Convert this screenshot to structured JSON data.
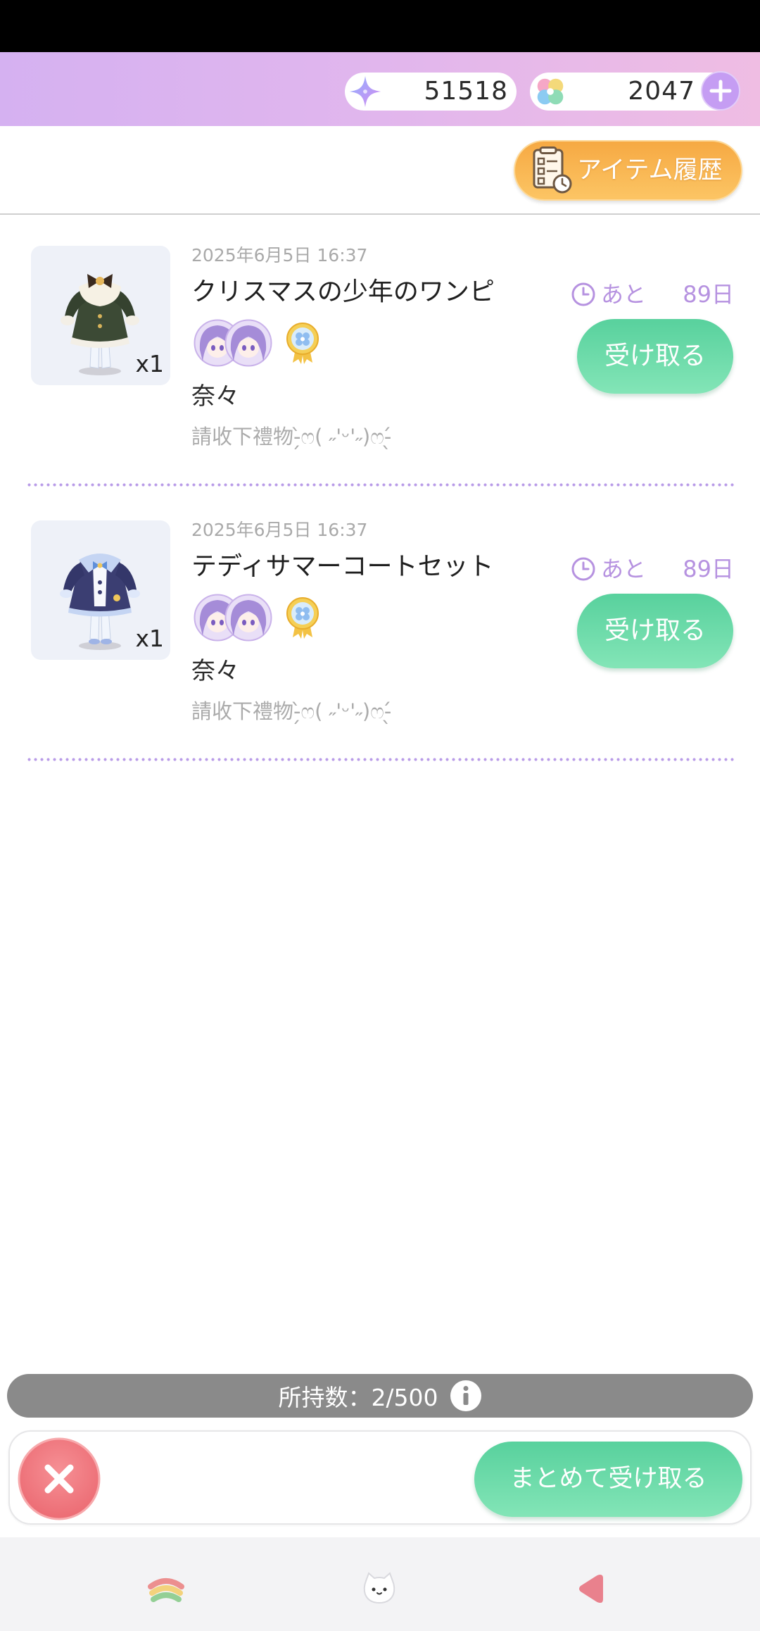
{
  "currency": {
    "primary": {
      "icon": "sparkle-icon",
      "value": "51518"
    },
    "secondary": {
      "icon": "clover-icon",
      "value": "2047"
    },
    "add_icon": "plus-icon"
  },
  "history_button": {
    "icon": "history-list-icon",
    "label": "アイテム履歴"
  },
  "gifts": [
    {
      "date": "2025年6月5日 16:37",
      "title": "クリスマスの少年のワンピ",
      "quantity": "x1",
      "sender_name": "奈々",
      "message": "請收下禮物-̗̀ෆ( ˶'ᵕ'˶)ෆ-̖́",
      "expiry_icon": "clock-icon",
      "expiry_prefix": "あと",
      "expiry_value": "89日",
      "claim_label": "受け取る"
    },
    {
      "date": "2025年6月5日 16:37",
      "title": "テディサマーコートセット",
      "quantity": "x1",
      "sender_name": "奈々",
      "message": "請收下禮物-̗̀ෆ( ˶'ᵕ'˶)ෆ-̖́",
      "expiry_icon": "clock-icon",
      "expiry_prefix": "あと",
      "expiry_value": "89日",
      "claim_label": "受け取る"
    }
  ],
  "footer": {
    "holding_label": "所持数：",
    "holding_count": "2/500",
    "info_icon": "info-icon",
    "close_icon": "close-icon",
    "claim_all_label": "まとめて受け取る"
  },
  "bottom_nav": {
    "icons": [
      "rainbow-icon",
      "cat-face-icon",
      "back-triangle-icon"
    ]
  },
  "colors": {
    "header_gradient_start": "#d5b1f1",
    "header_gradient_end": "#efbde3",
    "accent_purple": "#b692e0",
    "claim_green": "#58d19d",
    "history_orange": "#f6a943",
    "close_red": "#f07a80",
    "divider_dots": "#b99ce8",
    "holding_bar_gray": "#8a8a8a"
  }
}
